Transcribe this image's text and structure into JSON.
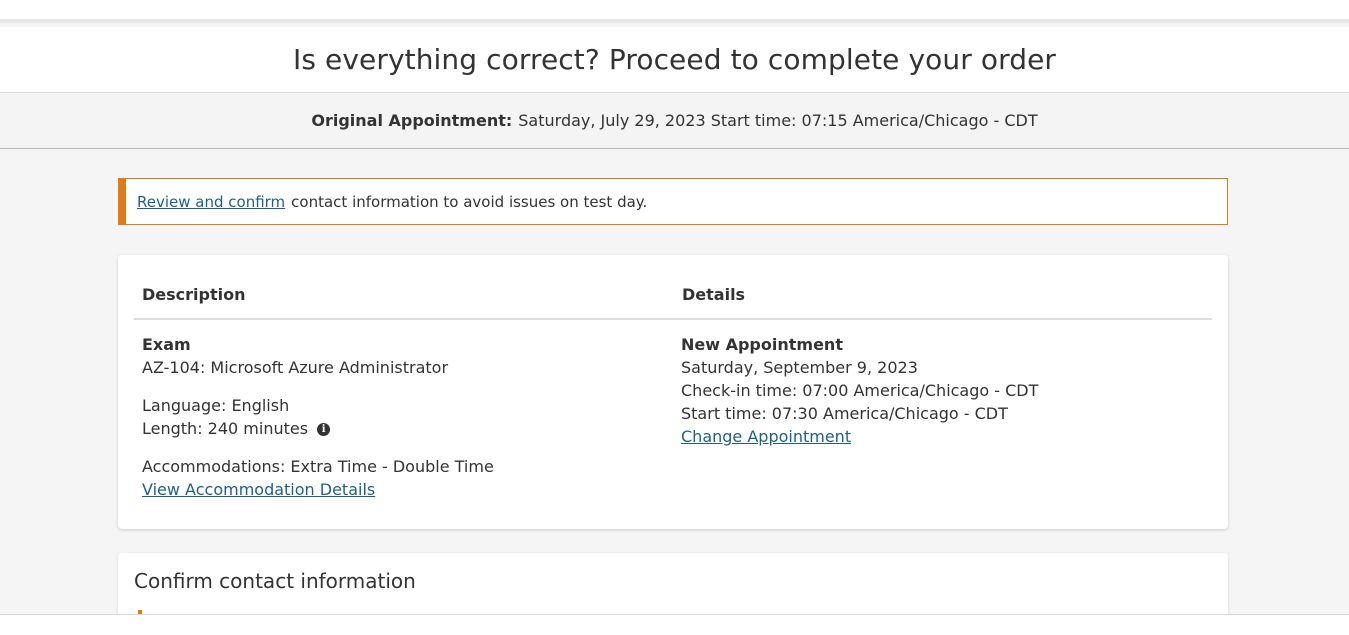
{
  "header": {
    "title": "Is everything correct? Proceed to complete your order"
  },
  "original_appointment": {
    "label": "Original Appointment:",
    "value": "Saturday, July 29, 2023 Start time: 07:15 America/Chicago - CDT"
  },
  "alert": {
    "link_text": "Review and confirm",
    "text": "contact information to avoid issues on test day.",
    "accent_color": "#e07b1a"
  },
  "order_table": {
    "headers": {
      "description": "Description",
      "details": "Details"
    },
    "description": {
      "type": "Exam",
      "exam_name": "AZ-104: Microsoft Azure Administrator",
      "language": "Language: English",
      "length": "Length: 240 minutes",
      "info_icon": "info-icon",
      "accommodations": "Accommodations: Extra Time - Double Time",
      "accommodation_link": "View Accommodation Details"
    },
    "details": {
      "heading": "New Appointment",
      "date": "Saturday, September 9, 2023",
      "checkin": "Check-in time: 07:00 America/Chicago - CDT",
      "start": "Start time: 07:30 America/Chicago - CDT",
      "change_link": "Change Appointment"
    }
  },
  "contact_section": {
    "title": "Confirm contact information"
  },
  "colors": {
    "link": "#1f5f8b",
    "warning": "#e07b1a"
  }
}
